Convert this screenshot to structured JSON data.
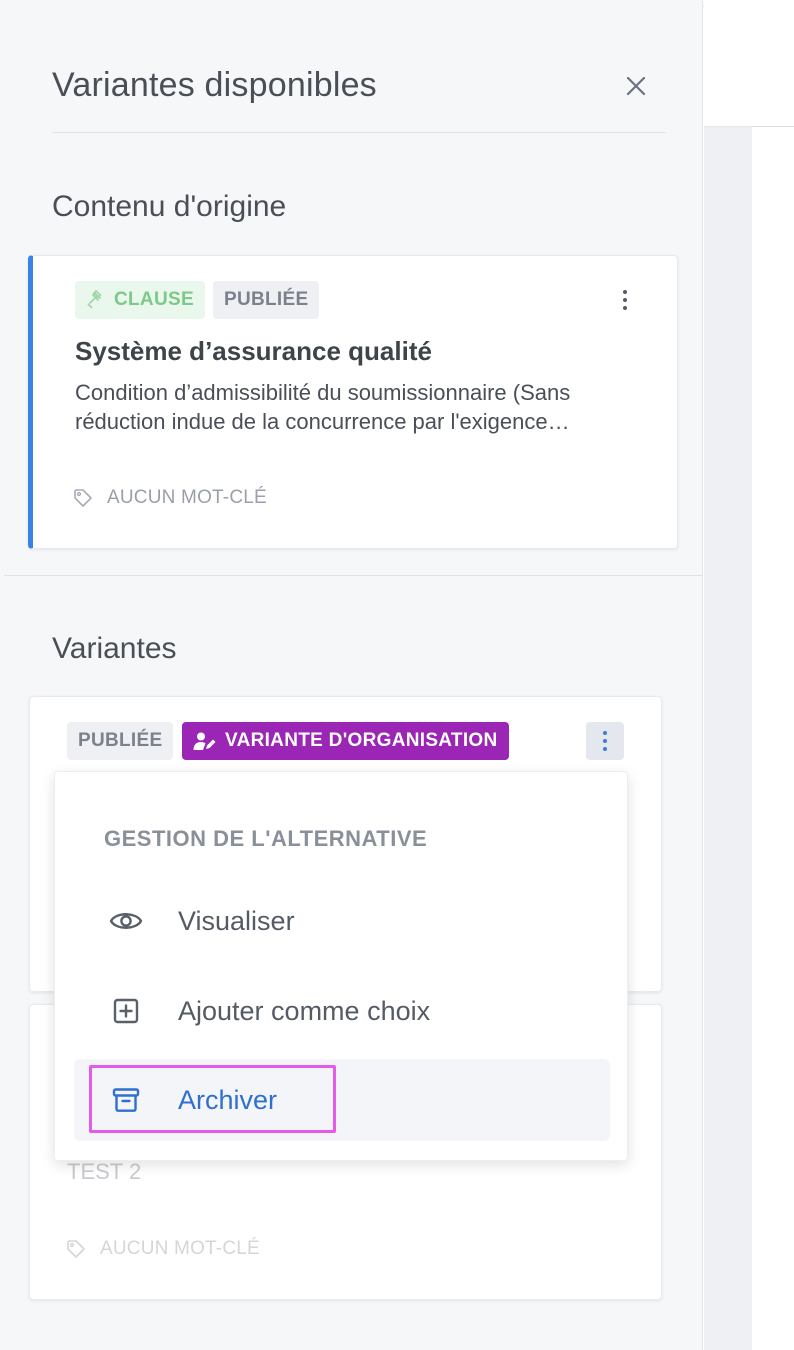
{
  "panel": {
    "title": "Variantes disponibles",
    "close_label": "×"
  },
  "origin": {
    "section_title": "Contenu d'origine",
    "card": {
      "type_badge": "CLAUSE",
      "status_badge": "PUBLIÉE",
      "title": "Système d’assurance qualité",
      "description": "Condition d’admissibilité du soumissionnaire (Sans réduction indue de la concurrence par l'exigence…",
      "keywords": "AUCUN MOT-CLÉ"
    }
  },
  "variants": {
    "section_title": "Variantes",
    "card1": {
      "status_badge": "PUBLIÉE",
      "type_badge": "VARIANTE D'ORGANISATION"
    },
    "card2": {
      "title": "TEST 2",
      "keywords": "AUCUN MOT-CLÉ"
    }
  },
  "menu": {
    "header": "GESTION DE L'ALTERNATIVE",
    "items": [
      {
        "label": "Visualiser",
        "icon": "eye-icon"
      },
      {
        "label": "Ajouter comme choix",
        "icon": "plus-square-icon"
      },
      {
        "label": "Archiver",
        "icon": "archive-icon"
      }
    ]
  },
  "colors": {
    "accent_blue": "#3b82e6",
    "org_badge": "#9b25b4",
    "clause_badge_text": "#7cc98a",
    "highlight": "#e45bea"
  }
}
